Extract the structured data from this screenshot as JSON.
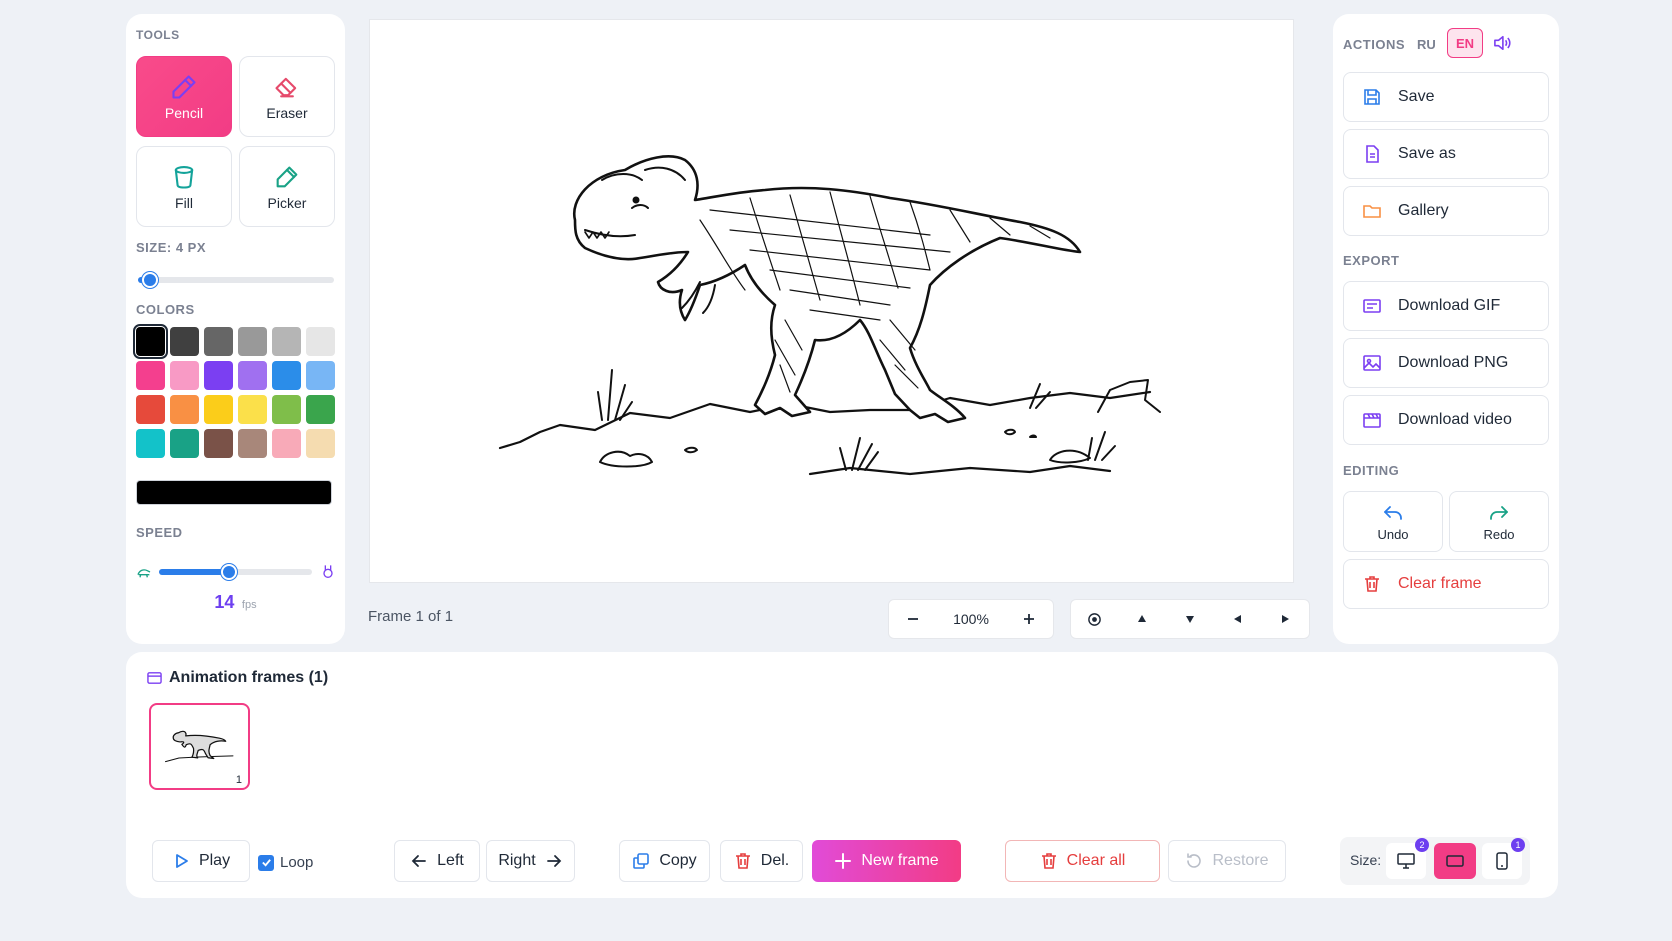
{
  "tools": {
    "section_title": "TOOLS",
    "items": [
      {
        "label": "Pencil",
        "icon": "pencil-icon",
        "active": true
      },
      {
        "label": "Eraser",
        "icon": "eraser-icon"
      },
      {
        "label": "Fill",
        "icon": "bucket-icon"
      },
      {
        "label": "Picker",
        "icon": "eyedropper-icon"
      }
    ],
    "size_label": "SIZE: 4 PX",
    "size_value": 4,
    "colors_title": "COLORS",
    "palette": [
      "#000000",
      "#404040",
      "#666666",
      "#999999",
      "#b5b5b5",
      "#e6e6e6",
      "#f43f8e",
      "#f89ac5",
      "#7b3ff2",
      "#a070f0",
      "#2b8de9",
      "#78b6f5",
      "#e64a3b",
      "#f99044",
      "#fbcd1a",
      "#fbe04a",
      "#7fbe4a",
      "#3aa54c",
      "#13c2c9",
      "#19a286",
      "#7a5248",
      "#a8877a",
      "#f8aab8",
      "#f5dcb0"
    ],
    "selected_color": "#000000",
    "speed_title": "SPEED",
    "speed_value": "14",
    "speed_unit": "fps"
  },
  "canvas": {
    "frame_info": "Frame 1 of 1",
    "zoom": "100%"
  },
  "actions": {
    "section_title": "ACTIONS",
    "lang_ru": "RU",
    "lang_en": "EN",
    "save": "Save",
    "save_as": "Save as",
    "gallery": "Gallery",
    "export_title": "EXPORT",
    "download_gif": "Download GIF",
    "download_png": "Download PNG",
    "download_video": "Download video",
    "editing_title": "EDITING",
    "undo": "Undo",
    "redo": "Redo",
    "clear_frame": "Clear frame"
  },
  "frames": {
    "title": "Animation frames (1)",
    "thumb_number": "1",
    "play": "Play",
    "loop": "Loop",
    "left": "Left",
    "right": "Right",
    "copy": "Copy",
    "delete": "Del.",
    "new_frame": "New frame",
    "clear_all": "Clear all",
    "restore": "Restore",
    "size_label": "Size:",
    "badge_desktop": "2",
    "badge_mobile": "1"
  },
  "colors": {
    "accent_pink": "#f23c85",
    "accent_blue": "#2b7de9",
    "danger": "#e53e3e"
  }
}
